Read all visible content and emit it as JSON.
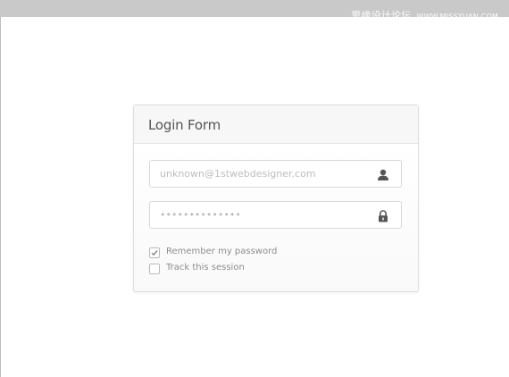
{
  "watermark": {
    "text": "思缘设计论坛",
    "site": "WWW.MISSYUAN.COM"
  },
  "login_form": {
    "title": "Login Form",
    "email_placeholder": "unknown@1stwebdesigner.com",
    "password_placeholder": "••••••••••••••",
    "email_icon": "user-icon",
    "password_icon": "lock-icon",
    "options": [
      {
        "label": "Remember my password",
        "checked": true
      },
      {
        "label": "Track this session",
        "checked": false
      }
    ]
  },
  "colors": {
    "topbar": "#c9c9c9",
    "card_border": "#dedede",
    "icon": "#555555"
  }
}
